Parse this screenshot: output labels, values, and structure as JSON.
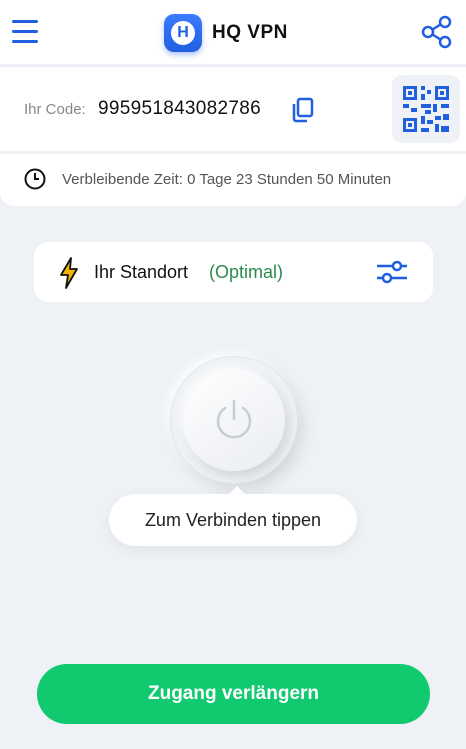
{
  "app": {
    "brand_name": "HQ VPN",
    "logo_letter": "H",
    "accent_color": "#1f5fe0",
    "success_color": "#11c96f"
  },
  "header": {
    "menu_icon": "hamburger-menu-icon",
    "share_icon": "share-icon"
  },
  "code": {
    "label": "Ihr Code:",
    "value": "995951843082786",
    "copy_icon": "copy-icon",
    "qr_icon": "qr-code-icon"
  },
  "time": {
    "icon": "clock-icon",
    "text": "Verbleibende Zeit: 0 Tage 23 Stunden 50 Minuten"
  },
  "location": {
    "icon": "lightning-bolt-icon",
    "label": "Ihr Standort",
    "status": "(Optimal)",
    "settings_icon": "sliders-icon"
  },
  "connection": {
    "power_icon": "power-icon",
    "hint": "Zum Verbinden tippen"
  },
  "footer": {
    "extend_label": "Zugang verlängern"
  }
}
